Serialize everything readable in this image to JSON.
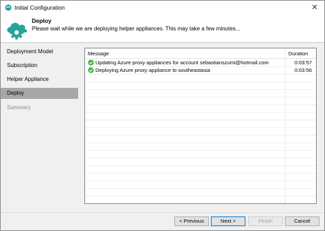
{
  "window": {
    "title": "Initial Configuration",
    "close_glyph": "✕"
  },
  "header": {
    "title": "Deploy",
    "subtitle": "Please wait while we are deploying helper appliances. This may take a few minutes..."
  },
  "sidebar": {
    "items": [
      {
        "label": "Deployment Model",
        "state": "normal"
      },
      {
        "label": "Subscription",
        "state": "normal"
      },
      {
        "label": "Helper Appliance",
        "state": "normal"
      },
      {
        "label": "Deploy",
        "state": "active"
      },
      {
        "label": "Summary",
        "state": "disabled"
      }
    ]
  },
  "grid": {
    "columns": {
      "message": "Message",
      "duration": "Duration"
    },
    "rows": [
      {
        "status_icon": "check-circle-icon",
        "message": "Updating Azure proxy appliances for account sebastianszumi@hotmail.com",
        "duration": "0:03:57"
      },
      {
        "status_icon": "check-circle-icon",
        "message": "Deploying Azure proxy appliance to southeastasia",
        "duration": "0:03:56"
      }
    ]
  },
  "buttons": {
    "previous": "< Previous",
    "next": "Next >",
    "finish": "Finish",
    "cancel": "Cancel"
  },
  "colors": {
    "accent": "#0078d7",
    "success": "#3fae3f",
    "active_nav": "#a7a7a7",
    "brand_icon": "#27a39a"
  }
}
